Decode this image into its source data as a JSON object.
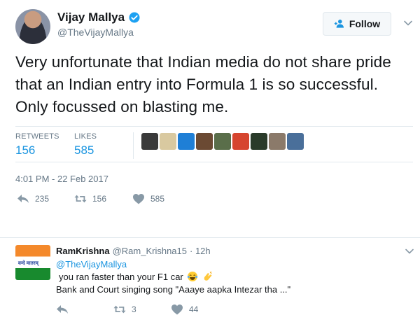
{
  "tweet": {
    "author_name": "Vijay Mallya",
    "author_handle": "@TheVijayMallya",
    "follow_label": "Follow",
    "text": "Very unfortunate that Indian media do not share pride that an Indian entry into Formula 1 is so successful. Only focussed on blasting me.",
    "retweets_label": "RETWEETS",
    "retweets_count": "156",
    "likes_label": "LIKES",
    "likes_count": "585",
    "timestamp": "4:01 PM - 22 Feb 2017",
    "actions": {
      "reply_count": "235",
      "retweet_count": "156",
      "like_count": "585"
    }
  },
  "liker_avatars": [
    "#3a3a3a",
    "#d9c9a0",
    "#1f7fd6",
    "#6b4a33",
    "#5a6e4a",
    "#d6452f",
    "#2a3b2a",
    "#8b7a6a",
    "#4a6f9a"
  ],
  "reply": {
    "author_name": "RamKrishna",
    "author_handle": "@Ram_Krishna15",
    "time": "· 12h",
    "mention": "@TheVijayMallya",
    "line1": "you ran faster than your F1 car",
    "line2": "Bank and Court singing song \"Aaaye aapka Intezar tha ...\"",
    "retweet_count": "3",
    "like_count": "44",
    "avatar_caption": "वन्दे मातरम्"
  },
  "colors": {
    "accent": "#1b95e0",
    "muted": "#657786",
    "divider": "#e1e8ed"
  },
  "icons": [
    "verified-icon",
    "follow-person-icon",
    "chevron-down-icon",
    "reply-icon",
    "retweet-icon",
    "heart-icon",
    "tears-of-joy-emoji",
    "clapping-hands-emoji"
  ]
}
